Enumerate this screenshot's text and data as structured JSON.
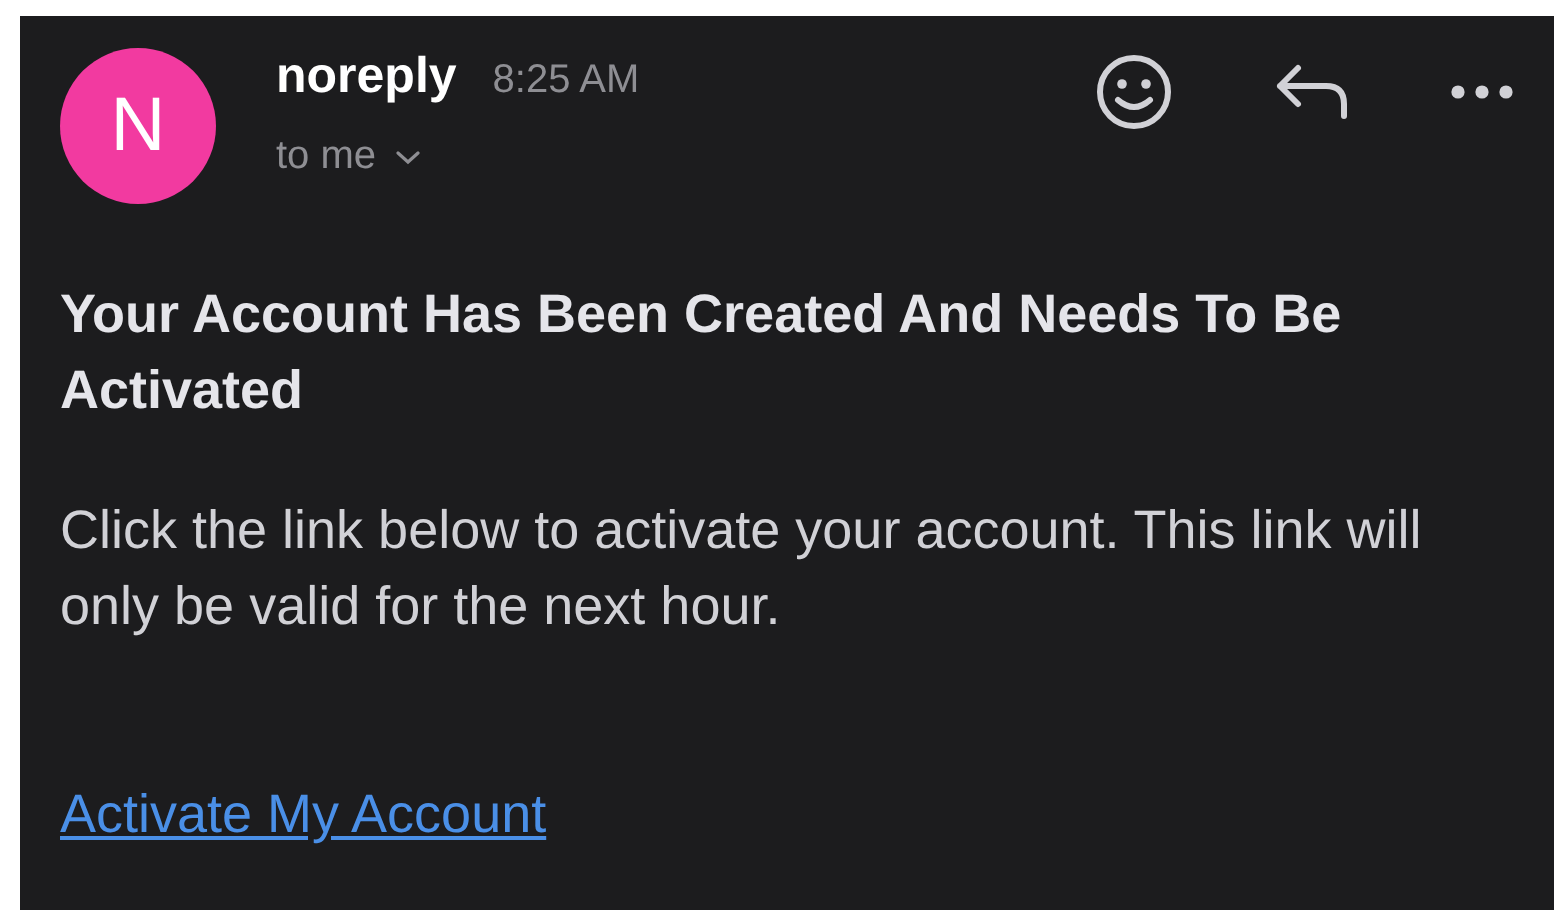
{
  "sender": {
    "initial": "N",
    "name": "noreply",
    "time": "8:25 AM",
    "recipient": "to me"
  },
  "subject": "Your Account Has Been Created And Needs To Be Activated",
  "body": "Click the link below to activate your account. This link will only be valid for the next hour.",
  "link": "Activate My Account"
}
